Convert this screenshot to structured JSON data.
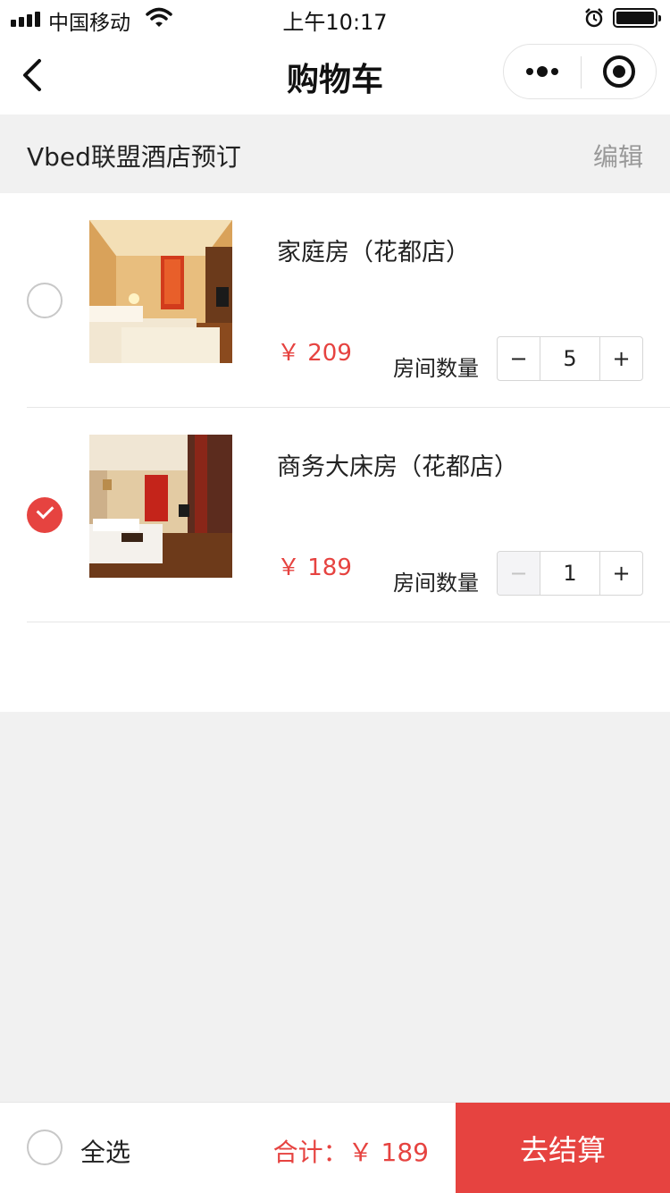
{
  "status_bar": {
    "carrier": "中国移动",
    "time": "上午10:17"
  },
  "nav": {
    "title": "购物车"
  },
  "shop": {
    "name": "Vbed联盟酒店预订",
    "edit_label": "编辑"
  },
  "items": [
    {
      "name": "家庭房（花都店）",
      "price": "￥ 209",
      "qty_label": "房间数量",
      "quantity": "5",
      "minus": "−",
      "plus": "+",
      "selected": false
    },
    {
      "name": "商务大床房（花都店）",
      "price": "￥ 189",
      "qty_label": "房间数量",
      "quantity": "1",
      "minus": "−",
      "plus": "+",
      "selected": true
    }
  ],
  "footer": {
    "select_all": "全选",
    "total": "合计：￥ 189",
    "checkout": "去结算"
  },
  "colors": {
    "accent": "#e64340",
    "page_bg": "#f1f1f1"
  }
}
